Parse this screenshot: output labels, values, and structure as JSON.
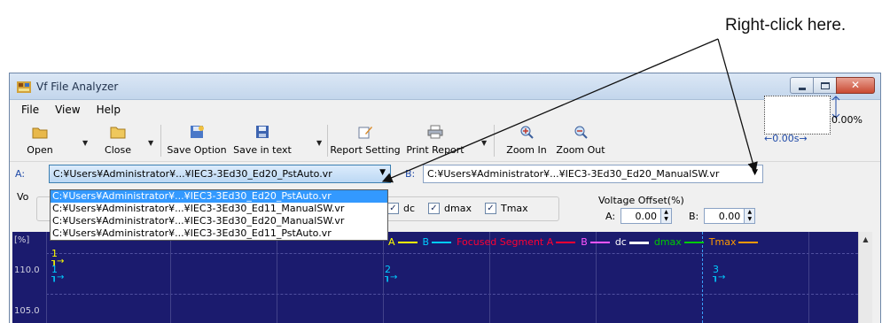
{
  "callout": "Right-click here.",
  "window": {
    "title": "Vf File Analyzer"
  },
  "menu": [
    "File",
    "View",
    "Help"
  ],
  "toolbar": {
    "open": "Open",
    "close": "Close",
    "save_option": "Save Option",
    "save_text": "Save in text",
    "report_setting": "Report Setting",
    "print_report": "Print Report",
    "zoom_in": "Zoom In",
    "zoom_out": "Zoom Out"
  },
  "file_a": {
    "label": "A:",
    "value": "C:¥Users¥Administrator¥...¥IEC3-3Ed30_Ed20_PstAuto.vr"
  },
  "file_b": {
    "label": "B:",
    "value": "C:¥Users¥Administrator¥...¥IEC3-3Ed30_Ed20_ManualSW.vr"
  },
  "dropdown_items": [
    "C:¥Users¥Administrator¥...¥IEC3-3Ed30_Ed20_PstAuto.vr",
    "C:¥Users¥Administrator¥...¥IEC3-3Ed30_Ed11_ManualSW.vr",
    "C:¥Users¥Administrator¥...¥IEC3-3Ed30_Ed20_ManualSW.vr",
    "C:¥Users¥Administrator¥...¥IEC3-3Ed30_Ed11_PstAuto.vr"
  ],
  "options": {
    "label": "Vo",
    "checks": [
      "dc",
      "dmax",
      "Tmax"
    ],
    "voltage_offset": {
      "title": "Voltage Offset(%)",
      "a_label": "A:",
      "a_value": "0.00",
      "b_label": "B:",
      "b_value": "0.00"
    }
  },
  "offset_box": {
    "pct": "0.00%",
    "sec": "0.00s"
  },
  "chart": {
    "unit": "[%]",
    "y_ticks": [
      "110.0",
      "105.0"
    ],
    "legend": [
      {
        "text": "A",
        "color": "#ffff00"
      },
      {
        "text": "B",
        "color": "#00ccff"
      },
      {
        "text": "Focused Segment A",
        "color": "#ff0033"
      },
      {
        "text": "B",
        "color": "#ff55ff"
      },
      {
        "text": "dc",
        "color": "#ffffff"
      },
      {
        "text": "dmax",
        "color": "#00cc00"
      },
      {
        "text": "Tmax",
        "color": "#ff9900"
      }
    ],
    "markers": [
      {
        "label": "1",
        "color": "#ffff00"
      },
      {
        "label": "1",
        "color": "#00ccff"
      },
      {
        "label": "2",
        "color": "#00ccff"
      },
      {
        "label": "3",
        "color": "#00ccff"
      }
    ]
  }
}
